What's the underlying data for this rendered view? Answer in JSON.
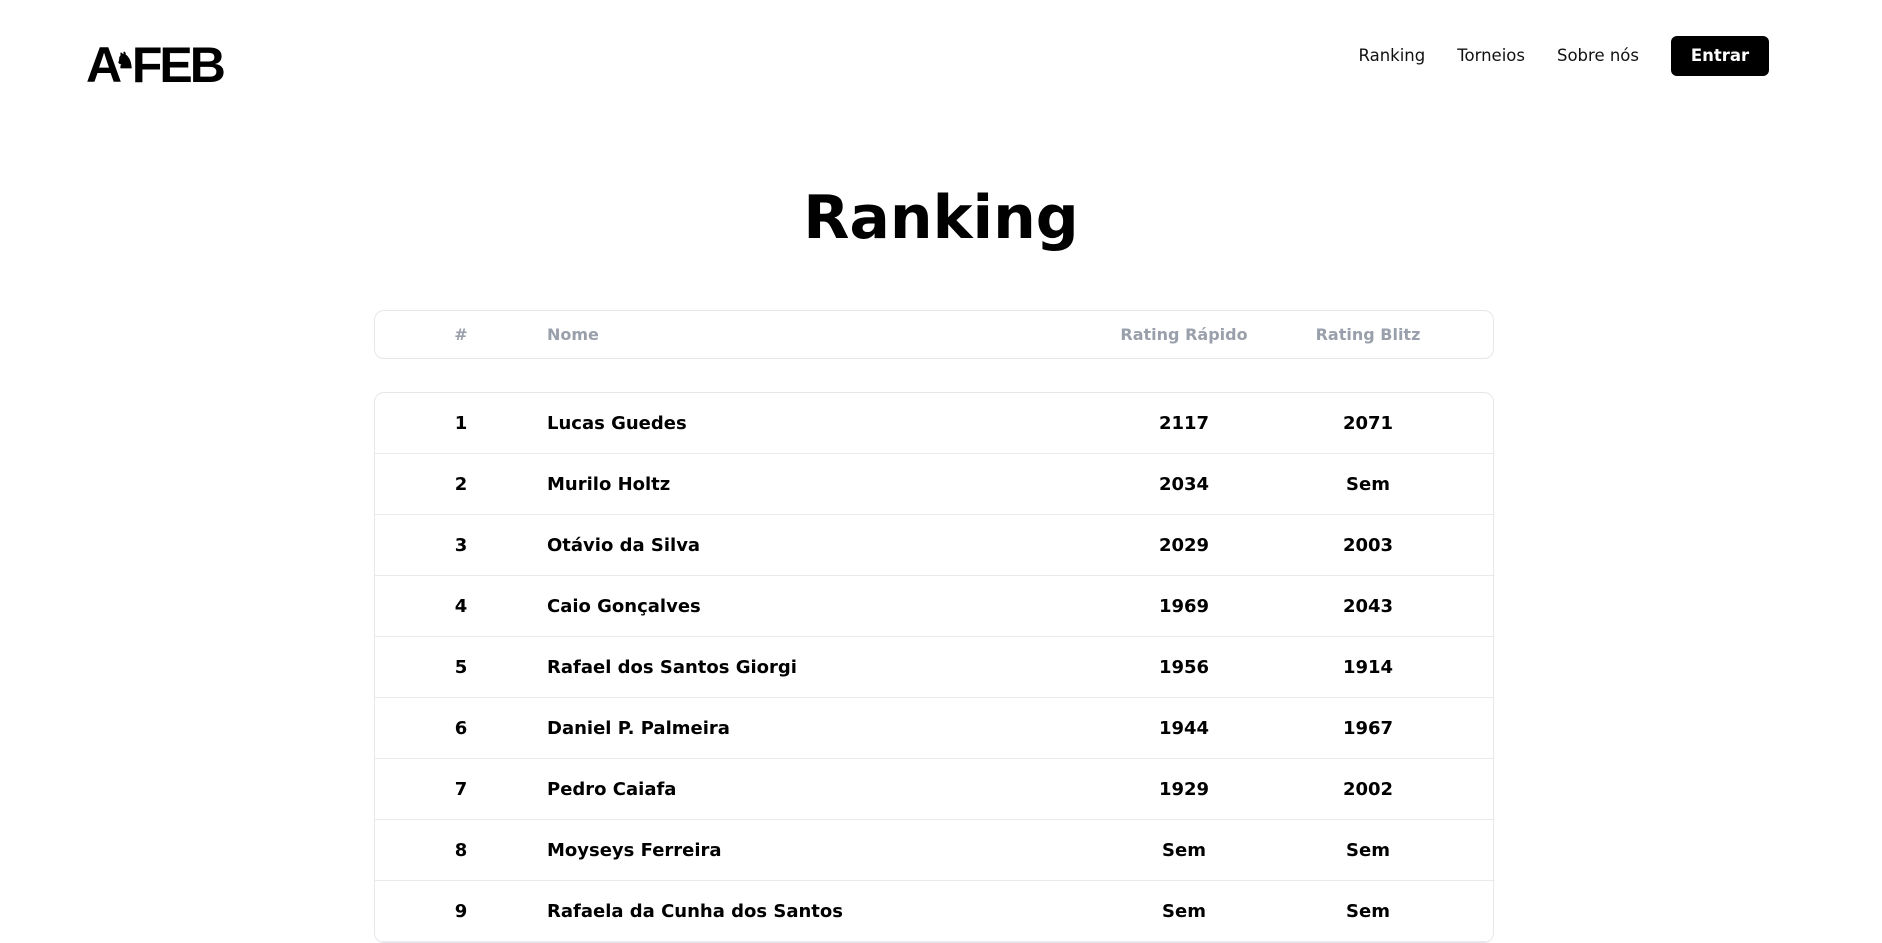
{
  "brand": {
    "logo_text_left": "A",
    "logo_text_right": "FEB",
    "logo_icon": "chess-knight-icon"
  },
  "nav": {
    "items": [
      {
        "label": "Ranking"
      },
      {
        "label": "Torneios"
      },
      {
        "label": "Sobre nós"
      }
    ],
    "login_label": "Entrar"
  },
  "page": {
    "title": "Ranking"
  },
  "table": {
    "columns": {
      "rank": "#",
      "name": "Nome",
      "rapid": "Rating Rápido",
      "blitz": "Rating Blitz"
    },
    "rows": [
      {
        "rank": "1",
        "name": "Lucas Guedes",
        "rapid": "2117",
        "blitz": "2071"
      },
      {
        "rank": "2",
        "name": "Murilo Holtz",
        "rapid": "2034",
        "blitz": "Sem"
      },
      {
        "rank": "3",
        "name": "Otávio da Silva",
        "rapid": "2029",
        "blitz": "2003"
      },
      {
        "rank": "4",
        "name": "Caio Gonçalves",
        "rapid": "1969",
        "blitz": "2043"
      },
      {
        "rank": "5",
        "name": "Rafael dos Santos Giorgi",
        "rapid": "1956",
        "blitz": "1914"
      },
      {
        "rank": "6",
        "name": "Daniel P. Palmeira",
        "rapid": "1944",
        "blitz": "1967"
      },
      {
        "rank": "7",
        "name": "Pedro Caiafa",
        "rapid": "1929",
        "blitz": "2002"
      },
      {
        "rank": "8",
        "name": "Moyseys Ferreira",
        "rapid": "Sem",
        "blitz": "Sem"
      },
      {
        "rank": "9",
        "name": "Rafaela da Cunha dos Santos",
        "rapid": "Sem",
        "blitz": "Sem"
      }
    ]
  }
}
